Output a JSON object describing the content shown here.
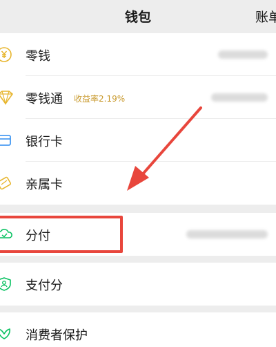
{
  "header": {
    "title": "钱包",
    "bill_label": "账单"
  },
  "group1": {
    "items": [
      {
        "label": "零钱",
        "icon": "yuan-coin-icon"
      },
      {
        "label": "零钱通",
        "icon": "diamond-icon",
        "badge": "收益率2.19%"
      },
      {
        "label": "银行卡",
        "icon": "bank-card-icon"
      },
      {
        "label": "亲属卡",
        "icon": "family-card-icon"
      }
    ]
  },
  "group2": {
    "items": [
      {
        "label": "分付",
        "icon": "fenfu-cloud-icon"
      }
    ]
  },
  "group3": {
    "items": [
      {
        "label": "支付分",
        "icon": "pay-score-icon"
      }
    ]
  },
  "group4": {
    "items": [
      {
        "label": "消费者保护",
        "icon": "consumer-protection-icon"
      }
    ]
  },
  "colors": {
    "accent_gold": "#e7b52d",
    "accent_green": "#07c160",
    "annotation_red": "#e8463c"
  }
}
